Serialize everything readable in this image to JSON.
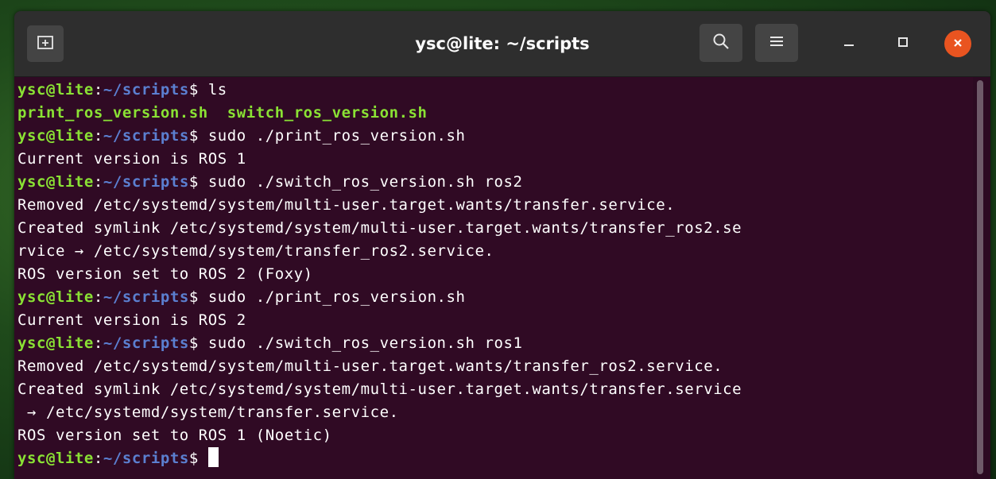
{
  "window": {
    "title": "ysc@lite: ~/scripts"
  },
  "prompt": {
    "user_host": "ysc@lite",
    "colon": ":",
    "path": "~/scripts",
    "dollar": "$"
  },
  "lines": [
    {
      "type": "prompt",
      "command": " ls"
    },
    {
      "type": "files",
      "items": [
        "print_ros_version.sh",
        "switch_ros_version.sh"
      ],
      "separator": "  "
    },
    {
      "type": "prompt",
      "command": " sudo ./print_ros_version.sh"
    },
    {
      "type": "output",
      "text": "Current version is ROS 1"
    },
    {
      "type": "prompt",
      "command": " sudo ./switch_ros_version.sh ros2"
    },
    {
      "type": "output",
      "text": "Removed /etc/systemd/system/multi-user.target.wants/transfer.service."
    },
    {
      "type": "output",
      "text": "Created symlink /etc/systemd/system/multi-user.target.wants/transfer_ros2.se"
    },
    {
      "type": "output",
      "text": "rvice → /etc/systemd/system/transfer_ros2.service."
    },
    {
      "type": "output",
      "text": "ROS version set to ROS 2 (Foxy)"
    },
    {
      "type": "prompt",
      "command": " sudo ./print_ros_version.sh"
    },
    {
      "type": "output",
      "text": "Current version is ROS 2"
    },
    {
      "type": "prompt",
      "command": " sudo ./switch_ros_version.sh ros1"
    },
    {
      "type": "output",
      "text": "Removed /etc/systemd/system/multi-user.target.wants/transfer_ros2.service."
    },
    {
      "type": "output",
      "text": "Created symlink /etc/systemd/system/multi-user.target.wants/transfer.service"
    },
    {
      "type": "output",
      "text": " → /etc/systemd/system/transfer.service."
    },
    {
      "type": "output",
      "text": "ROS version set to ROS 1 (Noetic)"
    },
    {
      "type": "prompt",
      "command": " ",
      "cursor": true
    }
  ],
  "icons": {
    "new_tab": "new-tab-icon",
    "search": "search-icon",
    "menu": "hamburger-menu-icon",
    "minimize": "minimize-icon",
    "maximize": "maximize-icon",
    "close": "close-icon"
  },
  "colors": {
    "terminal_bg": "#300a24",
    "titlebar_bg": "#2e2e2e",
    "prompt_user": "#8ae234",
    "prompt_path": "#5b7fd0",
    "executable": "#8ae234",
    "text": "#ffffff",
    "close_button": "#e95420"
  }
}
